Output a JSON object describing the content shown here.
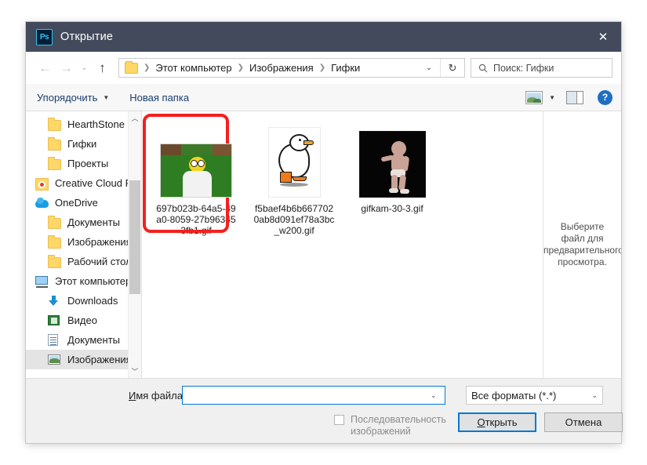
{
  "window": {
    "app_icon": "photoshop-icon",
    "app_icon_text": "Ps",
    "title": "Открытие",
    "close_label": "✕"
  },
  "navbar": {
    "back": "←",
    "forward": "→",
    "recent": "⌄",
    "up": "↑",
    "breadcrumbs": [
      "Этот компьютер",
      "Изображения",
      "Гифки"
    ],
    "separator": "❯",
    "dropdown": "⌄",
    "refresh": "↻",
    "search_placeholder": "Поиск: Гифки",
    "search_icon": "search-icon"
  },
  "commandbar": {
    "organize": "Упорядочить",
    "organize_caret": "▼",
    "new_folder": "Новая папка",
    "view_icon": "view-layout-icon",
    "view_caret": "▼",
    "preview_pane_icon": "preview-pane-icon",
    "help_icon": "help-icon",
    "help_label": "?"
  },
  "sidebar": {
    "items": [
      {
        "label": "HearthStone  He",
        "icon": "folder-icon",
        "level": "indent",
        "selected": false
      },
      {
        "label": "Гифки",
        "icon": "folder-icon",
        "level": "indent",
        "selected": false
      },
      {
        "label": "Проекты",
        "icon": "folder-icon",
        "level": "indent",
        "selected": false
      },
      {
        "label": "Creative Cloud Fil",
        "icon": "creative-cloud-icon",
        "level": "root",
        "selected": false
      },
      {
        "label": "OneDrive",
        "icon": "onedrive-icon",
        "level": "root",
        "selected": false
      },
      {
        "label": "Документы",
        "icon": "folder-icon",
        "level": "indent",
        "selected": false
      },
      {
        "label": "Изображения",
        "icon": "folder-icon",
        "level": "indent",
        "selected": false
      },
      {
        "label": "Рабочий стол",
        "icon": "folder-icon",
        "level": "indent",
        "selected": false
      },
      {
        "label": "Этот компьютер",
        "icon": "this-pc-icon",
        "level": "root",
        "selected": false
      },
      {
        "label": "Downloads",
        "icon": "downloads-icon",
        "level": "indent",
        "selected": false
      },
      {
        "label": "Видео",
        "icon": "video-icon",
        "level": "indent",
        "selected": false
      },
      {
        "label": "Документы",
        "icon": "documents-icon",
        "level": "indent",
        "selected": false
      },
      {
        "label": "Изображения",
        "icon": "pictures-icon",
        "level": "indent",
        "selected": true
      }
    ],
    "scroll_up": "︿",
    "scroll_down": "﹀"
  },
  "files": [
    {
      "name": "697b023b-64a5-49a0-8059-27b963453fb1.gif",
      "thumb": "homer-thumbnail",
      "highlighted": true
    },
    {
      "name": "f5baef4b6b6677020ab8d091ef78a3bc_w200.gif",
      "thumb": "duck-thumbnail",
      "highlighted": false
    },
    {
      "name": "gifkam-30-3.gif",
      "thumb": "baby-thumbnail",
      "highlighted": false
    }
  ],
  "preview": {
    "lines": [
      "Выберите",
      "файл для",
      "предварительного",
      "просмотра."
    ]
  },
  "footer": {
    "filename_label_accel": "И",
    "filename_label_rest": "мя файла:",
    "filename_value": "",
    "filename_chevron": "⌄",
    "filetype_value": "Все форматы (*.*)",
    "filetype_chevron": "⌄",
    "checkbox_label_line1": "Последовательность",
    "checkbox_label_line2": "изображений",
    "checkbox_checked": false,
    "open_accel": "О",
    "open_rest": "ткрыть",
    "cancel_label": "Отмена"
  },
  "colors": {
    "titlebar": "#434a5c",
    "accent": "#0078d7",
    "highlight_box": "#f22121",
    "folder": "#ffd766"
  }
}
